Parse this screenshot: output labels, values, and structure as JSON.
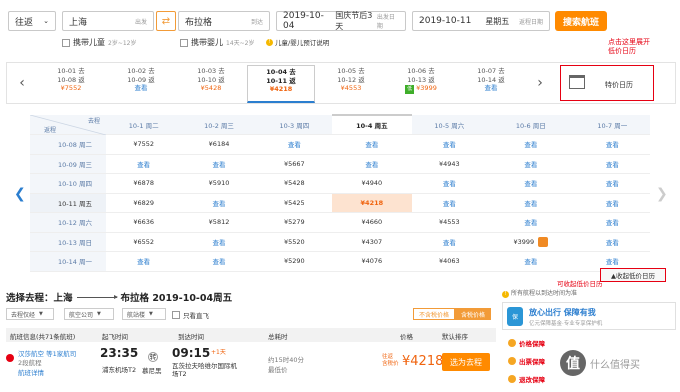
{
  "search": {
    "trip_type": "往返",
    "from_city": "上海",
    "from_hint": "出发",
    "swap_icon": "swap-icon",
    "to_city": "布拉格",
    "to_hint": "到达",
    "depart_date": "2019-10-04",
    "depart_note": "国庆节后3天",
    "depart_hint": "出发日期",
    "return_date": "2019-10-11",
    "return_weekday": "星期五",
    "return_hint": "返程日期",
    "search_button": "搜索航班",
    "child_label": "携带儿童",
    "child_sub": "2岁~12岁",
    "infant_label": "携带婴儿",
    "infant_sub": "14天~2岁",
    "ticket_info": "儿童/婴儿预订说明"
  },
  "strip": {
    "prev_icon": "chevron-left-icon",
    "next_icon": "chevron-right-icon",
    "days": [
      {
        "go": "10-01 去",
        "ret": "10-08 返",
        "price": "¥7552",
        "low": ""
      },
      {
        "go": "10-02 去",
        "ret": "10-09 返",
        "price": "查看",
        "low": ""
      },
      {
        "go": "10-03 去",
        "ret": "10-10 返",
        "price": "¥5428",
        "low": ""
      },
      {
        "go": "10-04 去",
        "ret": "10-11 返",
        "price": "¥4218",
        "low": ""
      },
      {
        "go": "10-05 去",
        "ret": "10-12 返",
        "price": "¥4553",
        "low": ""
      },
      {
        "go": "10-06 去",
        "ret": "10-13 返",
        "price": "¥3999",
        "low": "低"
      },
      {
        "go": "10-07 去",
        "ret": "10-14 返",
        "price": "查看",
        "low": ""
      }
    ],
    "calendar_label": "特价日历",
    "annotation": "点击这里展开\n低价日历"
  },
  "grid": {
    "corner_go": "去程",
    "corner_ret": "返程",
    "columns": [
      "10-1 周二",
      "10-2 周三",
      "10-3 周四",
      "10-4 周五",
      "10-5 周六",
      "10-6 周日",
      "10-7 周一"
    ],
    "rows": [
      {
        "label": "10-08 周二",
        "cells": [
          "¥7552",
          "¥6184",
          "查看",
          "查看",
          "查看",
          "查看",
          "查看"
        ]
      },
      {
        "label": "10-09 周三",
        "cells": [
          "查看",
          "查看",
          "¥5667",
          "查看",
          "¥4943",
          "查看",
          "查看"
        ]
      },
      {
        "label": "10-10 周四",
        "cells": [
          "¥6878",
          "¥5910",
          "¥5428",
          "¥4940",
          "查看",
          "查看",
          "查看"
        ]
      },
      {
        "label": "10-11 周五",
        "cells": [
          "¥6829",
          "查看",
          "¥5425",
          "¥4218",
          "查看",
          "查看",
          "查看"
        ]
      },
      {
        "label": "10-12 周六",
        "cells": [
          "¥6636",
          "¥5812",
          "¥5279",
          "¥4660",
          "¥4553",
          "查看",
          "查看"
        ]
      },
      {
        "label": "10-13 周日",
        "cells": [
          "¥6552",
          "查看",
          "¥5520",
          "¥4307",
          "查看",
          "¥3999",
          "查看"
        ]
      },
      {
        "label": "10-14 周一",
        "cells": [
          "查看",
          "查看",
          "¥5290",
          "¥4076",
          "¥4063",
          "查看",
          "查看"
        ]
      }
    ],
    "collapse_label": "▲收起低价日历",
    "collapse_note": "可收起低价日历"
  },
  "results": {
    "title_prefix": "选择去程：上海",
    "title_suffix": "布拉格  2019-10-04周五",
    "filters": [
      "去程仅经",
      "航空公司",
      "航站楼"
    ],
    "direct_only": "只看直飞",
    "toggle_a": "不含税价格",
    "toggle_b": "含税价格",
    "tax_note": "所有航程以到达时间为准",
    "headers": [
      "航班信息(共71条航班)",
      "起飞时间",
      "到达时间",
      "总耗时",
      "价格",
      "默认排序"
    ],
    "flight": {
      "airline": "汉莎航空 等1家航司",
      "stops": "2段航程",
      "detail": "航班详情",
      "dep_time": "23:35",
      "dep_airport": "浦东机场T2",
      "transfer": "转",
      "transfer_city": "慕尼黑",
      "arr_time": "09:15",
      "arr_plus": "+1天",
      "arr_airport": "瓦茨拉夫哈维尔国际机场T2",
      "duration": "约15时40分",
      "duration_note": "最低价",
      "price_label": "往返\n含税价",
      "price": "¥4218",
      "book": "选为去程"
    }
  },
  "side": {
    "promo_title": "放心出行 保障有我",
    "promo_sub": "亿元保障基金·专业专享保护机",
    "items": [
      "价格保障",
      "出票保障",
      "退改保障"
    ]
  },
  "watermark": "什么值得买"
}
